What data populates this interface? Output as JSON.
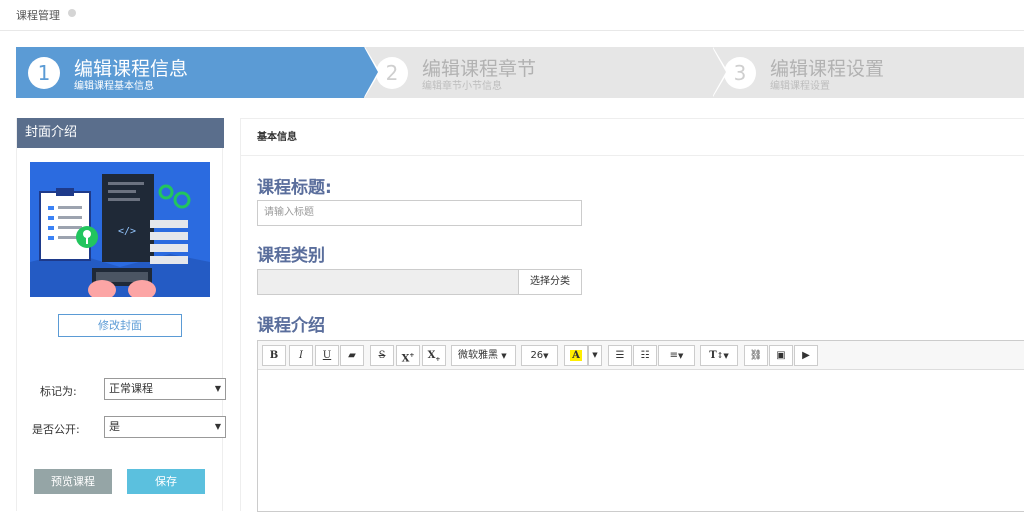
{
  "topbar": {
    "title": "课程管理"
  },
  "steps": [
    {
      "num": "1",
      "title": "编辑课程信息",
      "subtitle": "编辑课程基本信息"
    },
    {
      "num": "2",
      "title": "编辑课程章节",
      "subtitle": "编辑章节小节信息"
    },
    {
      "num": "3",
      "title": "编辑课程设置",
      "subtitle": "编辑课程设置"
    }
  ],
  "sidebar": {
    "header": "封面介绍",
    "cover_button": "修改封面",
    "mark_label": "标记为:",
    "mark_value": "正常课程",
    "public_label": "是否公开:",
    "public_value": "是",
    "preview_button": "预览课程",
    "save_button": "保存"
  },
  "main": {
    "header": "基本信息",
    "title_label": "课程标题:",
    "title_placeholder": "请输入标题",
    "category_label": "课程类别",
    "category_button": "选择分类",
    "intro_label": "课程介绍",
    "toolbar": {
      "font_family": "微软雅黑",
      "font_size": "26",
      "bold": "B",
      "italic": "I",
      "underline": "U",
      "strike": "S",
      "superscript": "X",
      "subscript": "X",
      "font_color": "A",
      "text_size": "T"
    }
  },
  "colors": {
    "accent": "#5b9bd5",
    "sidebar_header": "#5a6e8c",
    "save": "#5bc0de",
    "preview": "#95a5a6"
  }
}
